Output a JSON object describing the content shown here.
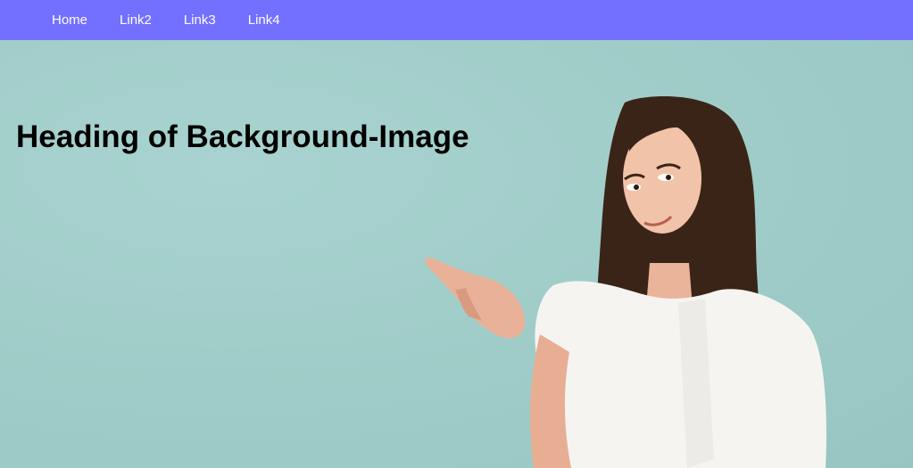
{
  "nav": {
    "links": [
      {
        "label": "Home"
      },
      {
        "label": "Link2"
      },
      {
        "label": "Link3"
      },
      {
        "label": "Link4"
      }
    ]
  },
  "hero": {
    "heading": "Heading of Background-Image"
  },
  "colors": {
    "navbar": "#736fff",
    "hero_background": "#a2cfcb",
    "nav_text": "#ffffff",
    "heading_text": "#000000"
  }
}
